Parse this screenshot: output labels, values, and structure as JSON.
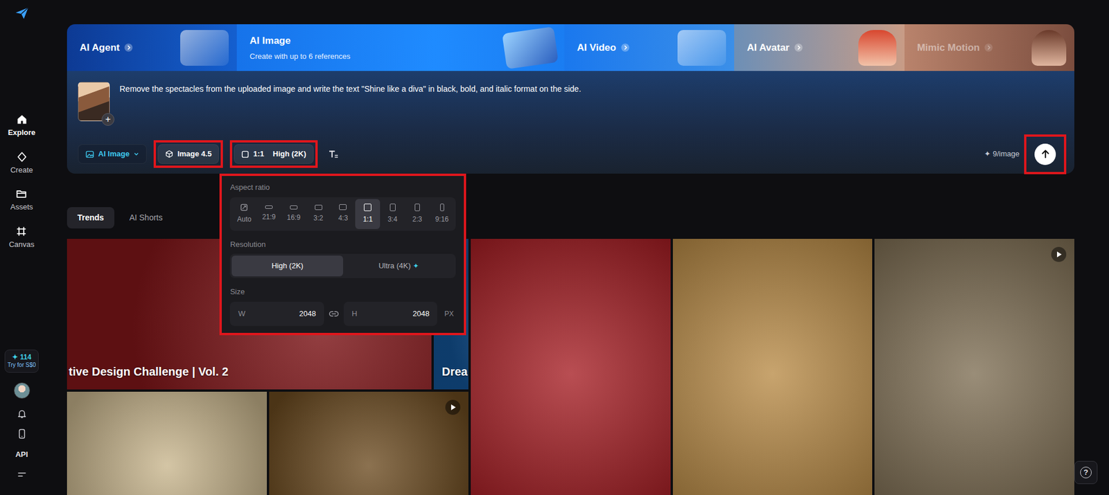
{
  "sidebar": {
    "items": [
      {
        "label": "Explore",
        "selected": true
      },
      {
        "label": "Create",
        "selected": false
      },
      {
        "label": "Assets",
        "selected": false
      },
      {
        "label": "Canvas",
        "selected": false
      }
    ],
    "credits": {
      "icon": "✦",
      "count": "114",
      "offer": "Try for S$0"
    },
    "api": "API"
  },
  "modes": [
    {
      "label": "AI Agent",
      "selected": false,
      "disabled": false
    },
    {
      "label": "AI Image",
      "subtitle": "Create with up to 6 references",
      "selected": true,
      "disabled": false
    },
    {
      "label": "AI Video",
      "selected": false,
      "disabled": false
    },
    {
      "label": "AI Avatar",
      "selected": false,
      "disabled": false
    },
    {
      "label": "Mimic Motion",
      "selected": false,
      "disabled": true
    }
  ],
  "prompt": {
    "text": "Remove the spectacles from the uploaded image and write the text \"Shine like a diva\" in black, bold, and italic format on the side.",
    "add_icon": "+"
  },
  "toolbar": {
    "mode": {
      "label": "AI Image"
    },
    "model": {
      "label": "Image 4.5",
      "highlighted": true
    },
    "settings": {
      "ratio": "1:1",
      "resolution": "High (2K)",
      "highlighted": true,
      "expanded": true
    },
    "cost": {
      "icon": "✦",
      "text": "9/image"
    },
    "send": {
      "highlighted": true
    }
  },
  "settings_panel": {
    "highlighted": true,
    "aspect_label": "Aspect ratio",
    "ratios": [
      {
        "label": "Auto",
        "selected": false
      },
      {
        "label": "21:9",
        "selected": false
      },
      {
        "label": "16:9",
        "selected": false
      },
      {
        "label": "3:2",
        "selected": false
      },
      {
        "label": "4:3",
        "selected": false
      },
      {
        "label": "1:1",
        "selected": true
      },
      {
        "label": "3:4",
        "selected": false
      },
      {
        "label": "2:3",
        "selected": false
      },
      {
        "label": "9:16",
        "selected": false
      }
    ],
    "resolution_label": "Resolution",
    "resolutions": [
      {
        "label": "High (2K)",
        "selected": true
      },
      {
        "label": "Ultra (4K)",
        "selected": false,
        "badge": "✦"
      }
    ],
    "size_label": "Size",
    "width": {
      "label": "W",
      "value": "2048"
    },
    "height": {
      "label": "H",
      "value": "2048"
    },
    "unit": "PX"
  },
  "feed_tabs": [
    {
      "label": "Trends",
      "selected": true
    },
    {
      "label": "AI Shorts",
      "selected": false
    }
  ],
  "gallery": {
    "carousel": [
      {
        "caption": "tive Design Challenge | Vol. 2",
        "color": "#7c1518"
      },
      {
        "caption": "Drea",
        "color": "#12508f"
      }
    ],
    "cards": [
      {
        "color": "#c8b58c",
        "video": false
      },
      {
        "color": "#6b4a1f",
        "video": true
      },
      {
        "color": "#a51c22",
        "video": false
      },
      {
        "color": "#b88a45",
        "video": false
      },
      {
        "color": "#7d6d52",
        "video": true
      }
    ]
  },
  "help": {
    "icon": "?"
  }
}
